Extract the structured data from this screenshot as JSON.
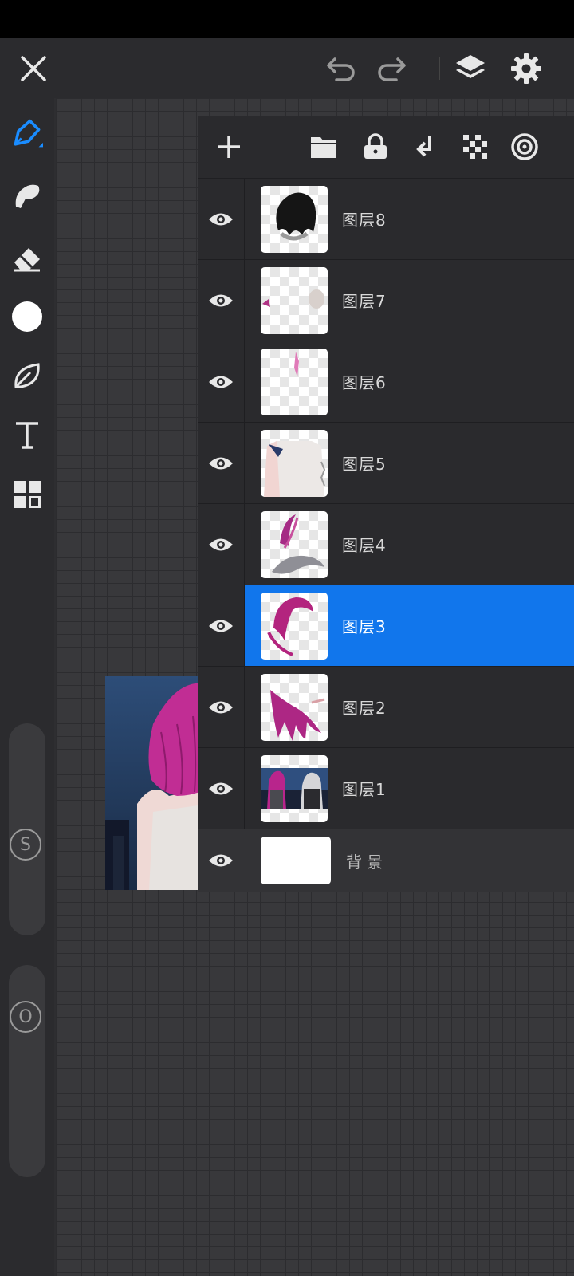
{
  "colors": {
    "accent": "#1176ec",
    "panel": "#2a2a2d",
    "icon": "#e8e8e8"
  },
  "topbar": {
    "close_icon": "close-icon",
    "undo_icon": "undo-icon",
    "redo_icon": "redo-icon",
    "layers_icon": "layers-icon",
    "settings_icon": "gear-icon"
  },
  "tools": [
    "brush-icon",
    "smudge-icon",
    "eraser-icon",
    "color-swatch",
    "leaf-shape-icon",
    "text-icon",
    "grid-icon"
  ],
  "sliders": {
    "size_label": "S",
    "opacity_label": "O"
  },
  "layer_toolbar": [
    "add-icon",
    "folder-icon",
    "lock-icon",
    "merge-down-icon",
    "transparency-icon",
    "blend-icon"
  ],
  "layers": [
    {
      "name": "图层8"
    },
    {
      "name": "图层7"
    },
    {
      "name": "图层6"
    },
    {
      "name": "图层5"
    },
    {
      "name": "图层4"
    },
    {
      "name": "图层3",
      "selected": true
    },
    {
      "name": "图层2"
    },
    {
      "name": "图层1"
    }
  ],
  "background_layer": {
    "name": "背景"
  }
}
